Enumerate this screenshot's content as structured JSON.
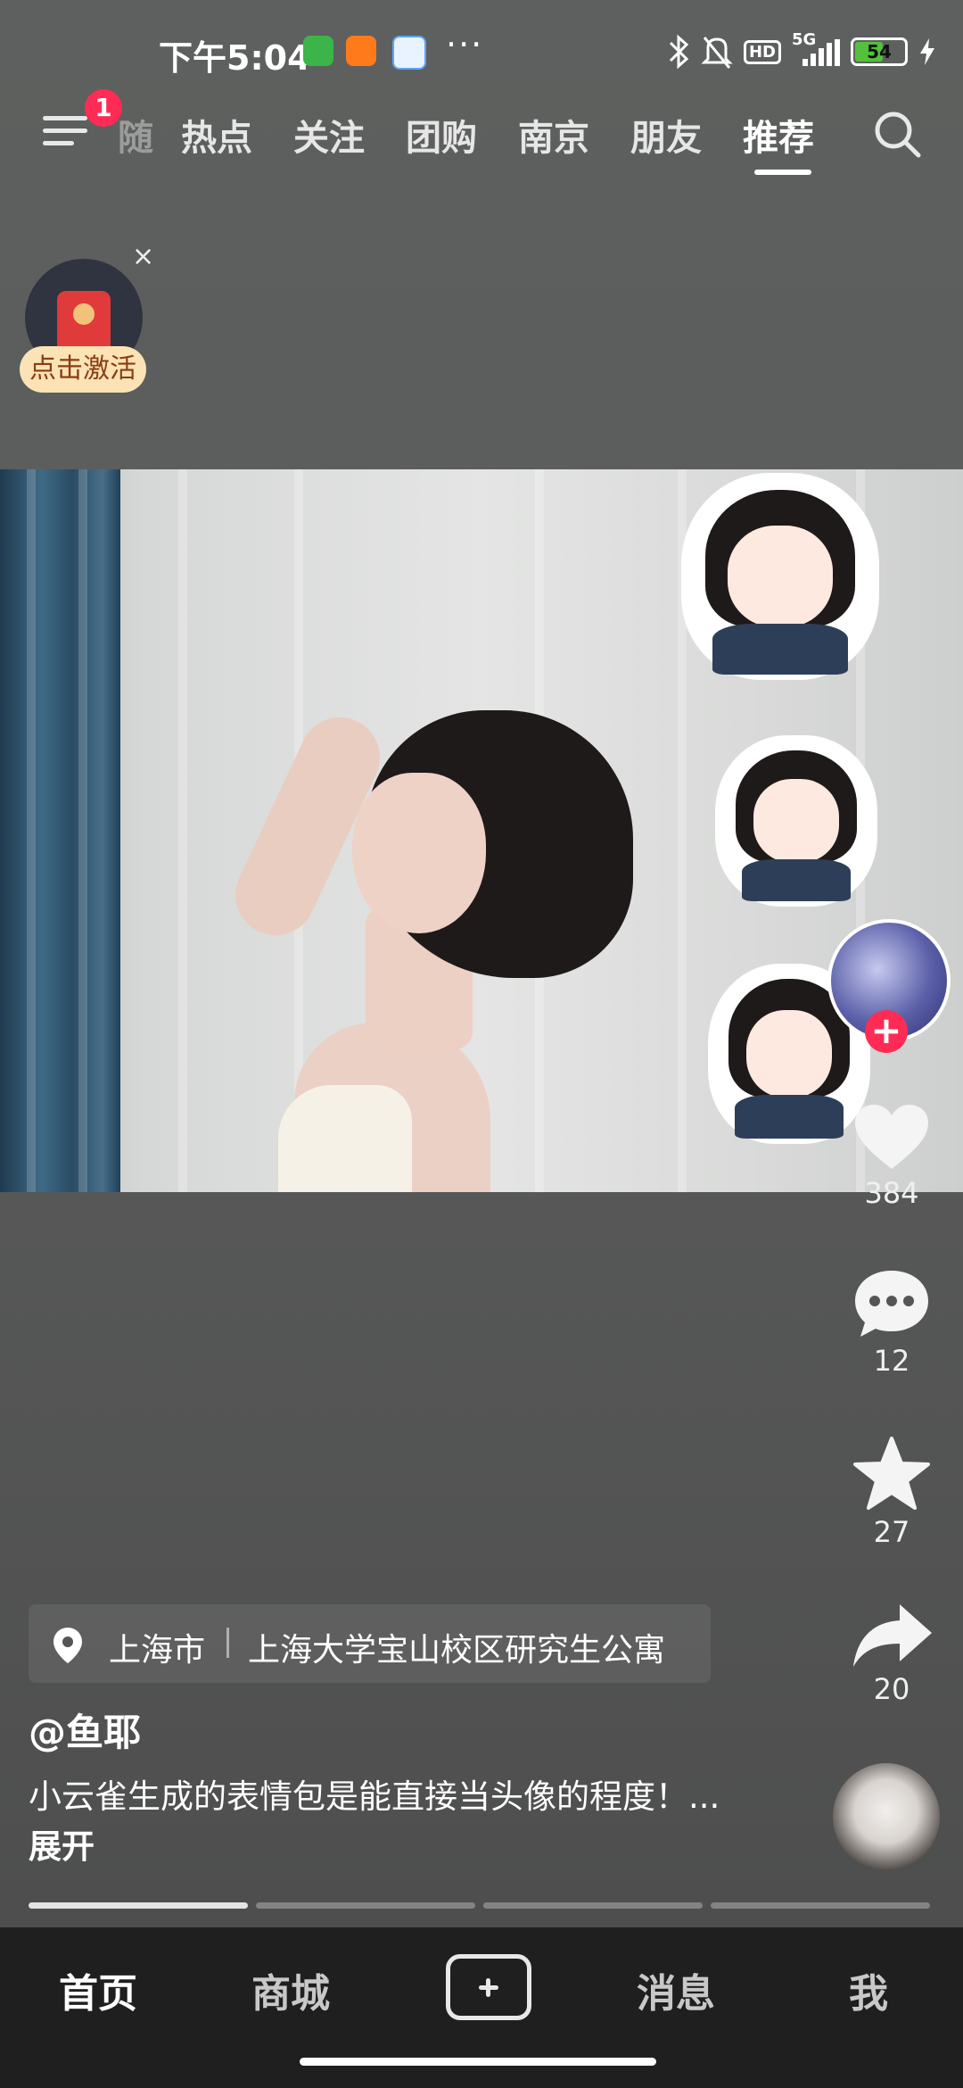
{
  "status_bar": {
    "time": "下午5:04",
    "app_icons": [
      "wechat-icon",
      "58-app-icon",
      "baidu-netdisk-icon"
    ],
    "more": "···",
    "icons": [
      "bluetooth-icon",
      "mute-icon",
      "hd-icon",
      "5g-signal-icon",
      "charging-icon"
    ],
    "hd": "HD",
    "network": "5G",
    "battery": "54"
  },
  "top_nav": {
    "menu_badge": "1",
    "tabs": [
      {
        "label": "随",
        "partial": true
      },
      {
        "label": "热点"
      },
      {
        "label": "关注"
      },
      {
        "label": "团购"
      },
      {
        "label": "南京"
      },
      {
        "label": "朋友"
      },
      {
        "label": "推荐",
        "active": true
      }
    ]
  },
  "red_packet": {
    "close": "×",
    "label": "点击激活"
  },
  "actions": {
    "likes": "384",
    "comments": "12",
    "favorites": "27",
    "shares": "20"
  },
  "post": {
    "location_city": "上海市",
    "location_place": "上海大学宝山校区研究生公寓",
    "username": "@鱼耶",
    "description": "小云雀生成的表情包是能直接当头像的程度！...",
    "expand": "展开"
  },
  "progress": {
    "segments": 4,
    "active_segment": 1
  },
  "bottom_tabs": [
    {
      "label": "首页",
      "active": true
    },
    {
      "label": "商城"
    },
    {
      "label": "消息"
    },
    {
      "label": "我"
    }
  ],
  "colors": {
    "accent": "#fe2c55",
    "tabbar_bg": "#1f1f1f",
    "packet_label_bg": "#fbe3b5"
  }
}
